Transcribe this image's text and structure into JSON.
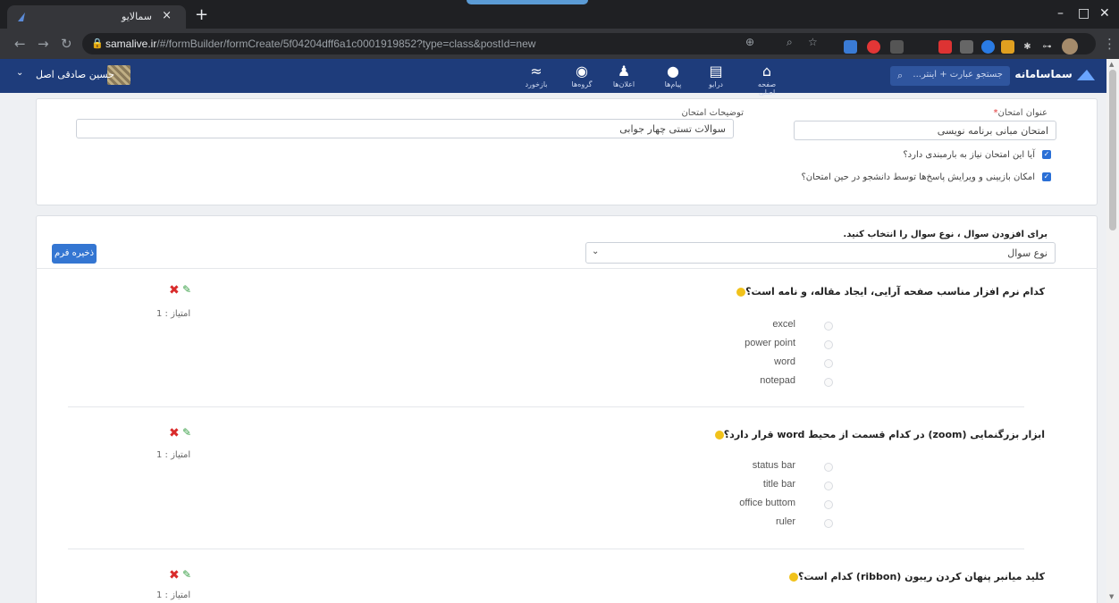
{
  "browser": {
    "tab_title": "سمالایو",
    "url_host": "samalive.ir",
    "url_path": "/#/formBuilder/formCreate/5f04204dff6a1c0001919852?type=class&postId=new"
  },
  "header": {
    "brand": "سماسامانه",
    "search_placeholder": "جستجو عبارت + اینتر...",
    "user_name": "حسین صادقی اصل",
    "nav": [
      {
        "label": "صفحه اصلی",
        "icon": "home-icon"
      },
      {
        "label": "درایو",
        "icon": "drive-icon"
      },
      {
        "label": "پیام‌ها",
        "icon": "chat-icon"
      },
      {
        "label": "اعلان‌ها",
        "icon": "bell-icon"
      },
      {
        "label": "گروه‌ها",
        "icon": "groups-icon"
      },
      {
        "label": "بازخورد",
        "icon": "feed-icon"
      }
    ]
  },
  "form": {
    "title_label": "عنوان امتحان",
    "title_value": "امتحان مبانی برنامه نویسی",
    "desc_label": "توضیحات امتحان",
    "desc_value": "سوالات تستی چهار جوابی",
    "check1": "آیا این امتحان نیاز به بارمبندی دارد؟",
    "check2": "امکان بازبینی و ویرایش پاسخ‌ها توسط دانشجو در حین امتحان؟"
  },
  "builder": {
    "add_label": "برای افزودن سوال ، نوع سوال را انتخاب کنید.",
    "select_value": "نوع سوال",
    "save_label": "ذخیره فرم",
    "questions": [
      {
        "title": "کدام نرم افزار مناسب صفحه آرایی، ایجاد مقاله، و نامه است؟",
        "score": "امتیاز : 1",
        "options": [
          "excel",
          "power point",
          "word",
          "notepad"
        ]
      },
      {
        "title": "ابزار بزرگنمایی (zoom) در کدام قسمت از محیط word  قرار دارد؟",
        "score": "امتیاز : 1",
        "options": [
          "status bar",
          "title bar",
          "office buttom",
          "ruler"
        ]
      },
      {
        "title": "کلید میانبر پنهان کردن ریبون (ribbon) کدام است؟",
        "score": "امتیاز : 1",
        "options": []
      }
    ]
  },
  "colors": {
    "nav": "#1e3c7b",
    "primary": "#3476d2",
    "danger": "#d92b2b",
    "success": "#3aa047"
  }
}
